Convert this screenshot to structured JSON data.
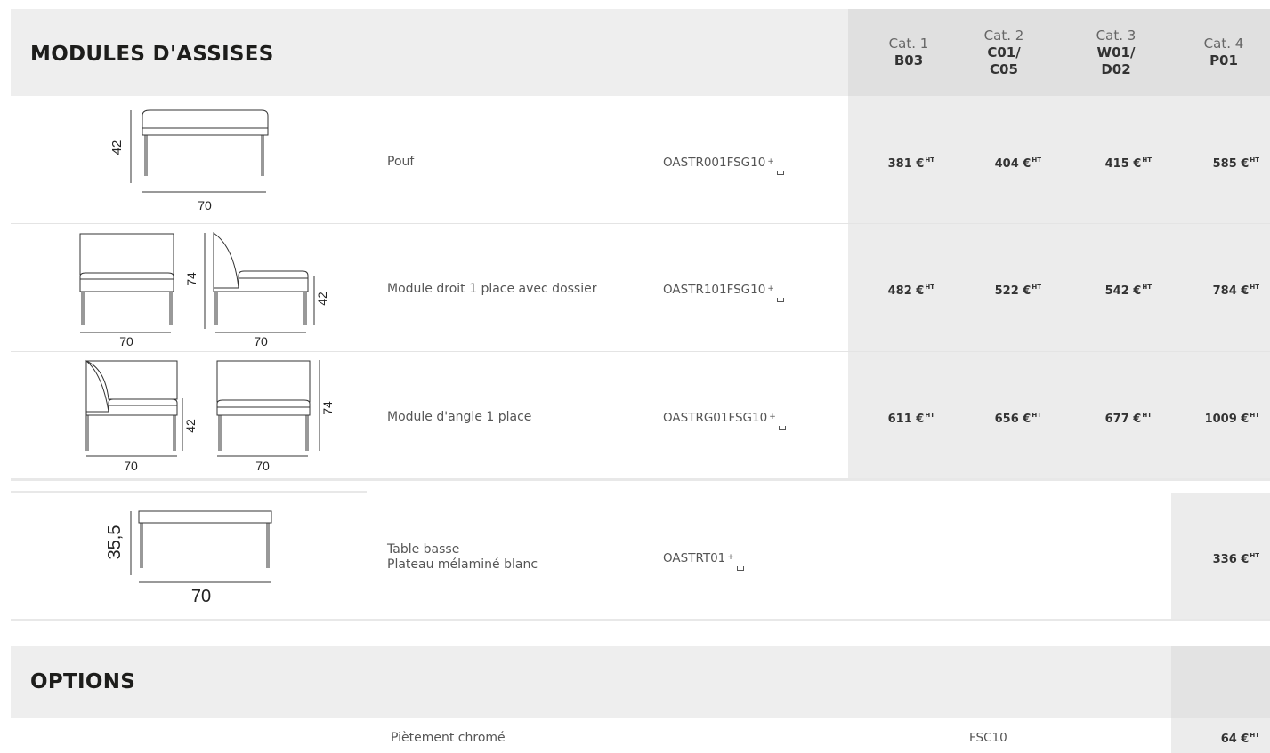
{
  "modules": {
    "title": "MODULES D'ASSISES",
    "categories": [
      {
        "name": "Cat. 1",
        "code_lines": [
          "B03"
        ]
      },
      {
        "name": "Cat. 2",
        "code_lines": [
          "C01/",
          "C05"
        ]
      },
      {
        "name": "Cat. 3",
        "code_lines": [
          "W01/",
          "D02"
        ]
      },
      {
        "name": "Cat. 4",
        "code_lines": [
          "P01"
        ]
      }
    ],
    "rows": [
      {
        "description": "Pouf",
        "reference": "OASTR001FSG10",
        "prices": [
          "381 €",
          "404 €",
          "415 €",
          "585 €"
        ],
        "dimensions": {
          "height": "42",
          "width": "70"
        }
      },
      {
        "description": "Module droit 1 place avec dossier",
        "reference": "OASTR101FSG10",
        "prices": [
          "482 €",
          "522 €",
          "542 €",
          "784 €"
        ],
        "dimensions": {
          "front_width": "70",
          "side_width": "70",
          "back_height": "74",
          "seat_height": "42"
        }
      },
      {
        "description": "Module d'angle 1 place",
        "reference": "OASTRG01FSG10",
        "prices": [
          "611 €",
          "656 €",
          "677 €",
          "1009 €"
        ],
        "dimensions": {
          "front_width": "70",
          "side_width": "70",
          "seat_height": "42",
          "back_height": "74"
        }
      },
      {
        "description_lines": [
          "Table basse",
          "Plateau mélaminé blanc"
        ],
        "reference": "OASTRT01",
        "prices": [
          "336 €"
        ],
        "dimensions": {
          "height": "35,5",
          "width": "70"
        }
      }
    ]
  },
  "price_suffix": "HT",
  "reference_marker": "+",
  "options": {
    "title": "OPTIONS",
    "rows": [
      {
        "description": "Piètement chromé",
        "code": "FSC10",
        "price": "64 €"
      }
    ]
  }
}
